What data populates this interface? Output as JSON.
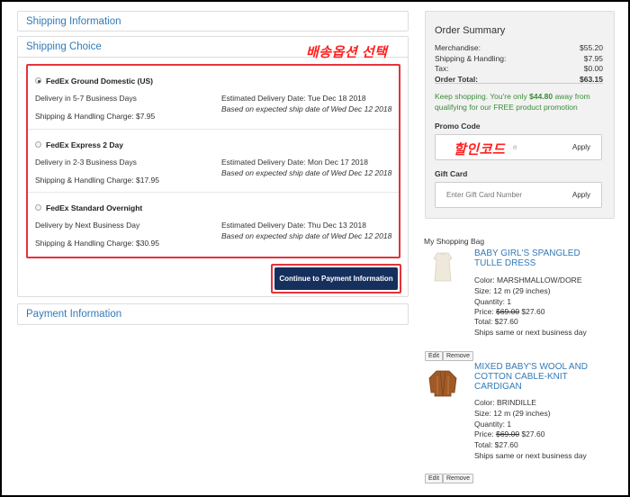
{
  "panels": {
    "shipping_information": "Shipping Information",
    "shipping_choice": "Shipping Choice",
    "payment_information": "Payment Information"
  },
  "annotations": {
    "shipping_option_select": "배송옵션 선택",
    "promo_code": "할인코드"
  },
  "shipping_options": [
    {
      "name": "FedEx Ground Domestic (US)",
      "selected": true,
      "delivery": "Delivery in 5-7 Business Days",
      "charge": "Shipping & Handling Charge: $7.95",
      "estimated": "Estimated Delivery Date: Tue Dec 18 2018",
      "based_on": "Based on expected ship date of Wed Dec 12 2018"
    },
    {
      "name": "FedEx Express 2 Day",
      "selected": false,
      "delivery": "Delivery in 2-3 Business Days",
      "charge": "Shipping & Handling Charge: $17.95",
      "estimated": "Estimated Delivery Date: Mon Dec 17 2018",
      "based_on": "Based on expected ship date of Wed Dec 12 2018"
    },
    {
      "name": "FedEx Standard Overnight",
      "selected": false,
      "delivery": "Delivery by Next Business Day",
      "charge": "Shipping & Handling Charge: $30.95",
      "estimated": "Estimated Delivery Date: Thu Dec 13 2018",
      "based_on": "Based on expected ship date of Wed Dec 12 2018"
    }
  ],
  "continue_button": "Continue to Payment Information",
  "summary": {
    "title": "Order Summary",
    "rows": [
      {
        "label": "Merchandise:",
        "value": "$55.20"
      },
      {
        "label": "Shipping & Handling:",
        "value": "$7.95"
      },
      {
        "label": "Tax:",
        "value": "$0.00"
      },
      {
        "label": "Order Total:",
        "value": "$63.15"
      }
    ],
    "keep_prefix": "Keep shopping. You're only ",
    "keep_amount": "$44.80",
    "keep_suffix": " away from qualifying for our FREE product promotion",
    "promo_label": "Promo Code",
    "promo_placeholder": "",
    "promo_visible_tail": "e",
    "apply": "Apply",
    "gift_label": "Gift Card",
    "gift_placeholder": "Enter Gift Card Number"
  },
  "bag": {
    "title": "My Shopping Bag",
    "items": [
      {
        "name": "BABY GIRL'S SPANGLED TULLE DRESS",
        "color": "Color: MARSHMALLOW/DORE",
        "size": "Size: 12 m (29 inches)",
        "quantity": "Quantity: 1",
        "price_label": "Price: ",
        "old_price": "$69.00",
        "new_price": " $27.60",
        "total": "Total: $27.60",
        "ships": "Ships same or next business day",
        "image_color": "#efe9dc"
      },
      {
        "name": "MIXED BABY'S WOOL AND COTTON CABLE-KNIT CARDIGAN",
        "color": "Color: BRINDILLE",
        "size": "Size: 12 m (29 inches)",
        "quantity": "Quantity: 1",
        "price_label": "Price: ",
        "old_price": "$69.00",
        "new_price": " $27.60",
        "total": "Total: $27.60",
        "ships": "Ships same or next business day",
        "image_color": "#a05a28"
      }
    ],
    "edit": "Edit",
    "remove": "Remove"
  }
}
